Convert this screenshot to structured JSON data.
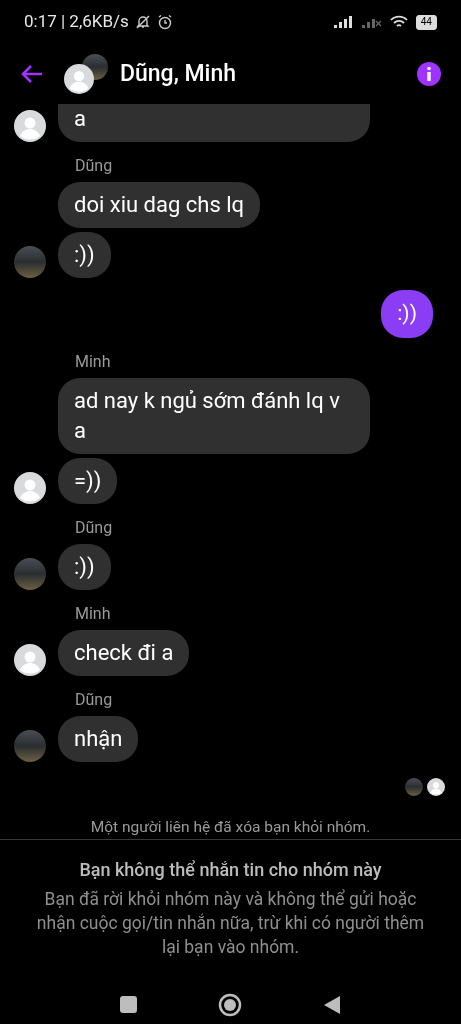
{
  "status_bar": {
    "time_speed": "0:17 | 2,6KB/s",
    "battery": "44"
  },
  "header": {
    "title": "Dũng, Minh"
  },
  "messages": [
    {
      "kind": "incoming",
      "avatar": {
        "kind": "default"
      },
      "bubbles": [
        "a"
      ],
      "cut_top": true
    },
    {
      "kind": "incoming",
      "sender": "Dũng",
      "avatar": {
        "kind": "photo"
      },
      "bubbles": [
        "doi xiu dag chs lq",
        ":))"
      ],
      "cut_top": false
    },
    {
      "kind": "outgoing",
      "bubbles": [
        ":))"
      ]
    },
    {
      "kind": "incoming",
      "sender": "Minh",
      "avatar": {
        "kind": "default"
      },
      "bubbles": [
        "ad nay k ngủ sớm đánh lq v a",
        "=))"
      ],
      "cut_top": false
    },
    {
      "kind": "incoming",
      "sender": "Dũng",
      "avatar": {
        "kind": "photo"
      },
      "bubbles": [
        ":))"
      ],
      "cut_top": false
    },
    {
      "kind": "incoming",
      "sender": "Minh",
      "avatar": {
        "kind": "default"
      },
      "bubbles": [
        "check đi a"
      ],
      "cut_top": false
    },
    {
      "kind": "incoming",
      "sender": "Dũng",
      "avatar": {
        "kind": "photo"
      },
      "bubbles": [
        "nhận"
      ],
      "cut_top": false
    }
  ],
  "seen_by": [
    {
      "kind": "photo"
    },
    {
      "kind": "default"
    }
  ],
  "notice": "Một người liên hệ đã xóa bạn khỏi nhóm.",
  "blocked": {
    "title": "Bạn không thể nhắn tin cho nhóm này",
    "body": "Bạn đã rời khỏi nhóm này và không thể gửi hoặc nhận cuộc gọi/tin nhắn nữa, trừ khi có người thêm lại bạn vào nhóm."
  }
}
